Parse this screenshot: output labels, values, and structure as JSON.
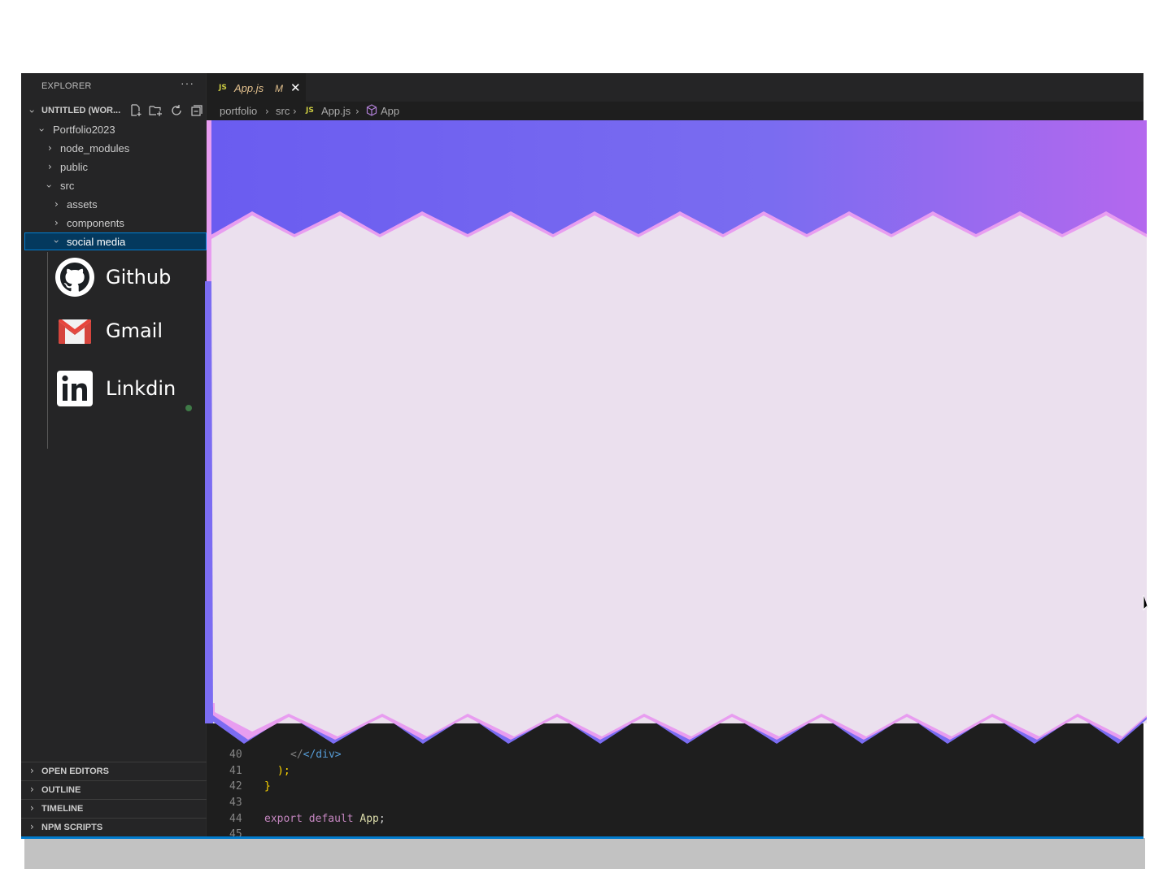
{
  "explorer": {
    "title": "EXPLORER",
    "more": "···",
    "workspace_label": "UNTITLED (WOR...",
    "icons": [
      "new-file-icon",
      "new-folder-icon",
      "refresh-icon",
      "collapse-all-icon"
    ]
  },
  "tree": {
    "root": "Portfolio2023",
    "items": [
      {
        "label": "node_modules"
      },
      {
        "label": "public"
      },
      {
        "label": "src"
      },
      {
        "label": "assets"
      },
      {
        "label": "components"
      },
      {
        "label": "social media"
      }
    ]
  },
  "social": [
    {
      "label": "Github",
      "icon": "github-icon"
    },
    {
      "label": "Gmail",
      "icon": "gmail-icon"
    },
    {
      "label": "Linkdin",
      "icon": "linkedin-icon"
    }
  ],
  "panels": [
    "OPEN EDITORS",
    "OUTLINE",
    "TIMELINE",
    "NPM SCRIPTS"
  ],
  "tab": {
    "badge": "JS",
    "name": "App.js",
    "modified": "M",
    "close": "✕"
  },
  "breadcrumb": {
    "parts": [
      "portfolio",
      "src",
      "App.js",
      "App"
    ],
    "badge": "JS"
  },
  "code_lines": [
    {
      "num": "40",
      "text": "</div>"
    },
    {
      "num": "41",
      "text": ");"
    },
    {
      "num": "42",
      "text": "}"
    },
    {
      "num": "43",
      "text": ""
    },
    {
      "num": "44",
      "text": "export default App;"
    },
    {
      "num": "45",
      "text": ""
    }
  ],
  "colors": {
    "accent": "#007acc",
    "overlay_top": "#6a5cf0",
    "overlay_body": "#ebe0ee",
    "overlay_edge_pink": "#e89df0"
  }
}
